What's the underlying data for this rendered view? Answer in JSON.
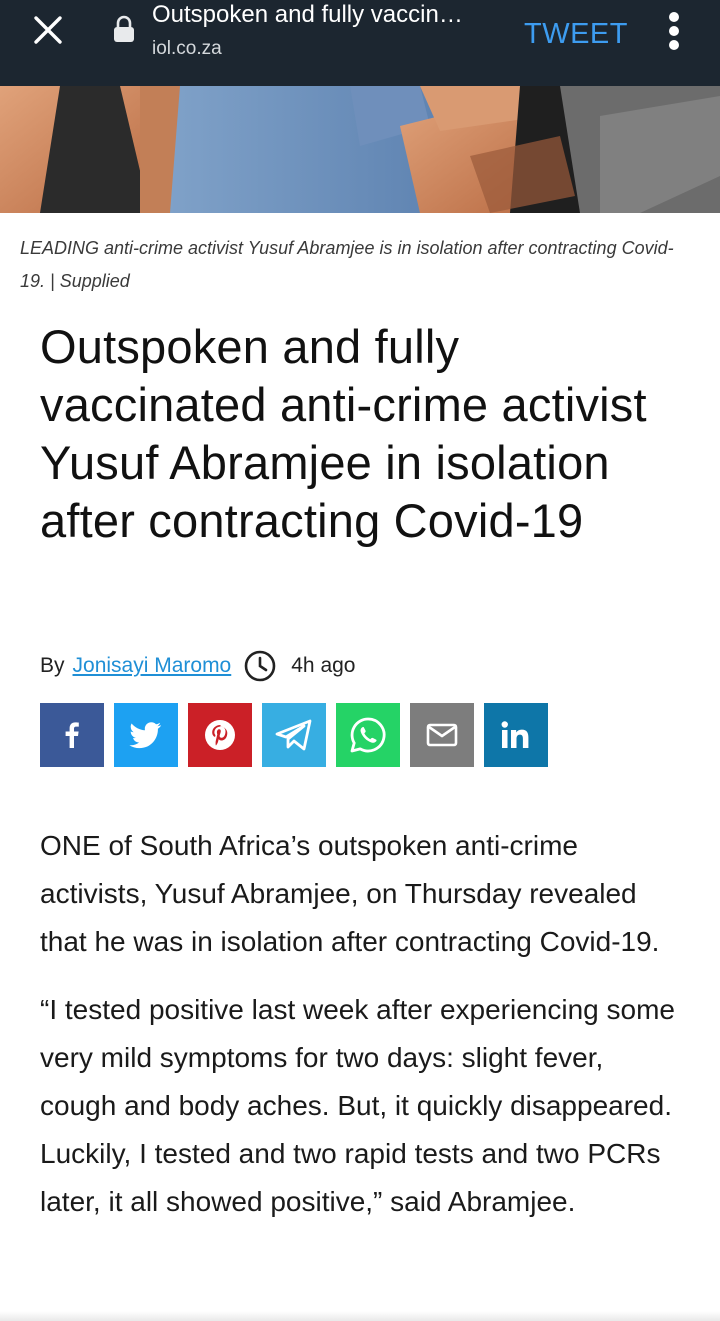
{
  "browser": {
    "page_title": "Outspoken and fully vaccin…",
    "domain": "iol.co.za",
    "action_label": "TWEET",
    "icons": [
      "close-icon",
      "lock-icon",
      "overflow-menu-icon"
    ]
  },
  "article": {
    "hero_image": "photo-of-people-hero-image",
    "caption": "LEADING anti-crime activist Yusuf Abramjee is in isolation after contracting Covid-19. | Supplied",
    "headline": "Outspoken and fully vaccinated anti-crime activist Yusuf Abramjee in isolation after contracting Covid-19",
    "byline": {
      "by_label": "By",
      "author": "Jonisayi Maromo",
      "time_icon": "clock-icon",
      "time": "4h ago"
    },
    "share": [
      {
        "name": "facebook",
        "icon": "facebook-icon",
        "color": "#3b5998"
      },
      {
        "name": "twitter",
        "icon": "twitter-icon",
        "color": "#1da1f2"
      },
      {
        "name": "pinterest",
        "icon": "pinterest-icon",
        "color": "#cb2027"
      },
      {
        "name": "telegram",
        "icon": "telegram-icon",
        "color": "#37aee2"
      },
      {
        "name": "whatsapp",
        "icon": "whatsapp-icon",
        "color": "#25d366"
      },
      {
        "name": "email",
        "icon": "email-icon",
        "color": "#7d7d7d"
      },
      {
        "name": "linkedin",
        "icon": "linkedin-icon",
        "color": "#0e76a8"
      }
    ],
    "paragraphs": [
      "ONE of South Africa’s outspoken anti-crime activists, Yusuf Abramjee, on Thursday revealed that he was in isolation after contracting Covid-19.",
      "“I tested positive last week after experiencing some very mild symptoms for two days: slight fever, cough and body aches. But, it quickly disappeared. Luckily, I tested and two rapid tests and two PCRs later, it all showed positive,” said Abramjee."
    ]
  }
}
